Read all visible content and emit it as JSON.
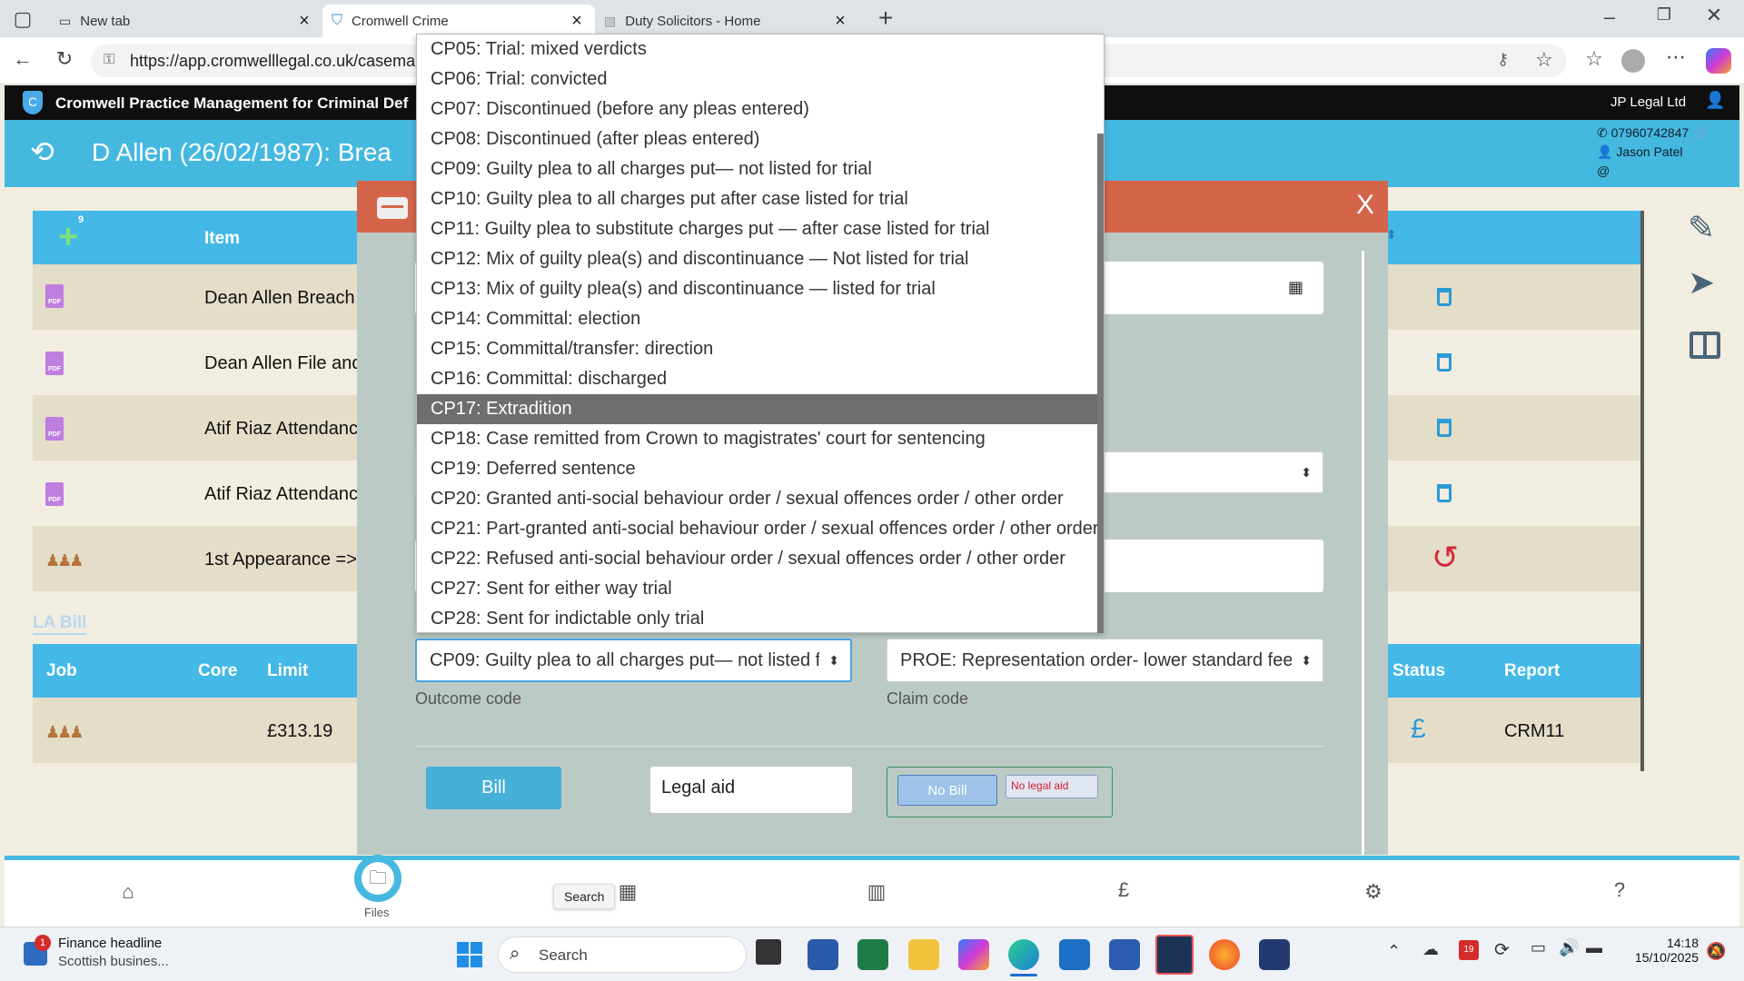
{
  "browser": {
    "tabs": [
      {
        "label": "New tab"
      },
      {
        "label": "Cromwell Crime"
      },
      {
        "label": "Duty Solicitors - Home"
      }
    ],
    "url": "https://app.cromwelllegal.co.uk/caseman"
  },
  "app": {
    "title": "Cromwell Practice Management for Criminal Def",
    "company": "JP Legal Ltd",
    "case_title": "D Allen (26/02/1987): Brea",
    "contact": {
      "phone": "07960742847",
      "name": "Jason Patel",
      "email_symbol": "@"
    }
  },
  "items_table": {
    "add_badge": "9",
    "header_item": "Item",
    "rows": [
      {
        "icon": "pdf",
        "text": "Dean Allen Breach"
      },
      {
        "icon": "pdf",
        "text": "Dean Allen File and"
      },
      {
        "icon": "pdf",
        "text": "Atif Riaz Attendanc"
      },
      {
        "icon": "pdf",
        "text": "Atif Riaz Attendanc"
      },
      {
        "icon": "people",
        "text": "1st Appearance =>"
      }
    ]
  },
  "la_bill": {
    "label": "LA Bill",
    "headers": {
      "job": "Job",
      "core": "Core",
      "limit": "Limit",
      "status": "Status",
      "report": "Report"
    },
    "row": {
      "limit": "£313.19",
      "status_symbol": "£",
      "report": "CRM11"
    }
  },
  "modal": {
    "close": "X",
    "outcome_value": "CP09: Guilty plea to all charges put— not listed f",
    "outcome_label": "Outcome code",
    "claim_value": "PROE: Representation order- lower standard fee",
    "claim_label": "Claim code",
    "bill_button": "Bill",
    "legal_aid": "Legal aid",
    "no_bill": "No Bill",
    "no_legal_aid": "No legal aid"
  },
  "dropdown": {
    "selected_index": 12,
    "options": [
      "CP05: Trial: mixed verdicts",
      "CP06: Trial: convicted",
      "CP07: Discontinued (before any pleas entered)",
      "CP08: Discontinued (after pleas entered)",
      "CP09: Guilty plea to all charges put— not listed for trial",
      "CP10: Guilty plea to all charges put after case listed for trial",
      "CP11: Guilty plea to substitute charges put — after case listed for trial",
      "CP12: Mix of guilty plea(s) and discontinuance — Not listed for trial",
      "CP13: Mix of guilty plea(s) and discontinuance — listed for trial",
      "CP14: Committal: election",
      "CP15: Committal/transfer: direction",
      "CP16: Committal: discharged",
      "CP17: Extradition",
      "CP18: Case remitted from Crown to magistrates' court for sentencing",
      "CP19: Deferred sentence",
      "CP20: Granted anti-social behaviour order / sexual offences order / other order",
      "CP21: Part-granted anti-social behaviour order / sexual offences order / other order",
      "CP22: Refused anti-social behaviour order / sexual offences order / other order",
      "CP27: Sent for either way trial",
      "CP28: Sent for indictable only trial"
    ]
  },
  "bottom_nav": {
    "files_label": "Files",
    "search_tooltip": "Search",
    "pound": "£",
    "help": "?"
  },
  "taskbar": {
    "news_title": "Finance headline",
    "news_sub": "Scottish busines...",
    "news_badge": "1",
    "search": "Search",
    "time": "14:18",
    "date": "15/10/2025",
    "calendar_badge": "19"
  }
}
